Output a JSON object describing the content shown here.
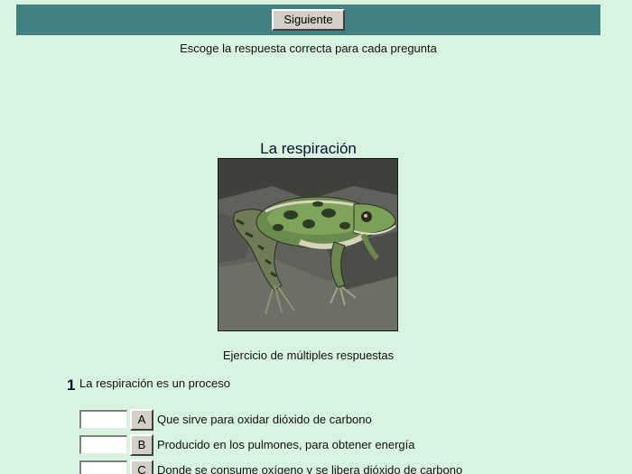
{
  "colors": {
    "background": "#d8f4e0",
    "nav_bar": "#418181",
    "button_face": "#d4d0c8"
  },
  "navigation": {
    "next_label": "Siguiente"
  },
  "instructions": "Escoge la respuesta correcta para cada pregunta",
  "section_title": "La respiración",
  "image": {
    "subject": "frog",
    "icon": "frog-photo"
  },
  "exercise_label": "Ejercicio de múltiples respuestas",
  "question": {
    "number": "1",
    "text": "La respiración es un proceso",
    "options": [
      {
        "letter": "A",
        "text": "Que sirve para oxidar dióxido de carbono",
        "value": ""
      },
      {
        "letter": "B",
        "text": "Producido en los pulmones, para obtener energía",
        "value": ""
      },
      {
        "letter": "C",
        "text": "Donde se consume oxígeno y se libera dióxido de carbono",
        "value": ""
      }
    ]
  }
}
